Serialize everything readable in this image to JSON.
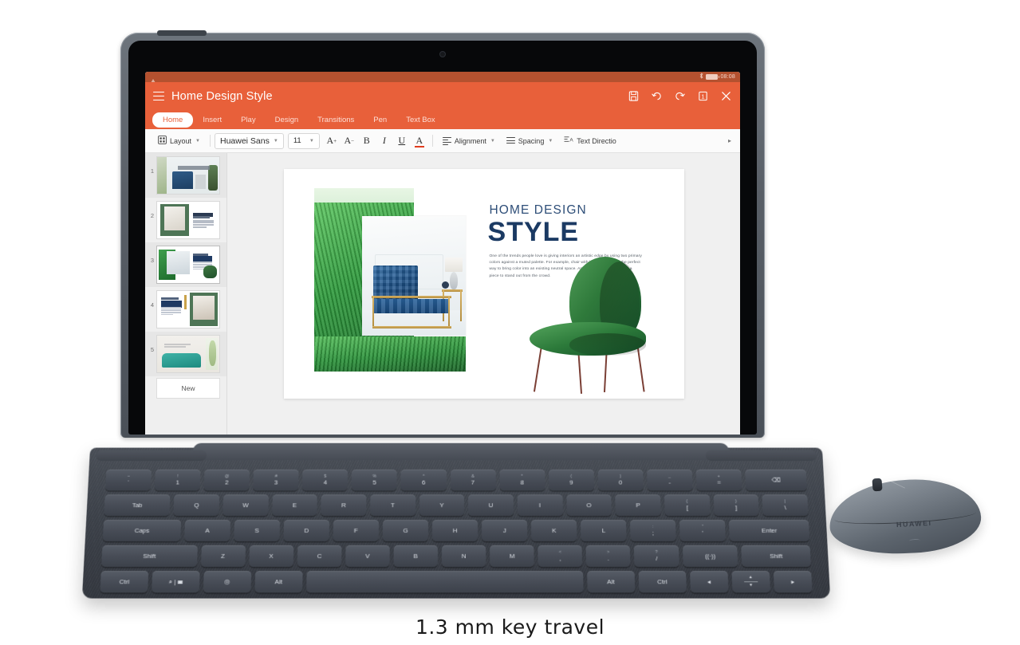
{
  "device": {
    "name": "huawei-tablet-with-keyboard-and-mouse",
    "mouse_brand": "HUAWEI"
  },
  "caption": "1.3 mm key travel",
  "status_bar": {
    "time": "08:08",
    "bluetooth_icon": "bluetooth-icon",
    "battery_icon": "battery-icon",
    "app_icon": "app-icon"
  },
  "titlebar": {
    "menu_icon": "hamburger-menu-icon",
    "document_title": "Home Design Style",
    "actions": [
      {
        "name": "save-icon",
        "label": "Save"
      },
      {
        "name": "undo-icon",
        "label": "Undo"
      },
      {
        "name": "redo-icon",
        "label": "Redo"
      },
      {
        "name": "page-number-icon",
        "label": "1"
      },
      {
        "name": "close-icon",
        "label": "Close"
      }
    ]
  },
  "ribbon": {
    "tabs": [
      {
        "label": "Home",
        "active": true
      },
      {
        "label": "Insert",
        "active": false
      },
      {
        "label": "Play",
        "active": false
      },
      {
        "label": "Design",
        "active": false
      },
      {
        "label": "Transitions",
        "active": false
      },
      {
        "label": "Pen",
        "active": false
      },
      {
        "label": "Text Box",
        "active": false
      }
    ]
  },
  "format_toolbar": {
    "layout_label": "Layout",
    "font_family": "Huawei Sans",
    "font_size": "11",
    "increase_font_label": "A",
    "decrease_font_label": "A",
    "bold_label": "B",
    "italic_label": "I",
    "underline_label": "U",
    "font_color_label": "A",
    "font_color_swatch": "#e03c1e",
    "alignment_label": "Alignment",
    "spacing_label": "Spacing",
    "text_direction_label": "Text Directio",
    "overflow_label": "▸"
  },
  "thumbnails": {
    "new_slide_label": "New",
    "slides": [
      {
        "number": "1",
        "title": "HOME DESIGN STYLE",
        "selected": false
      },
      {
        "number": "2",
        "title": "SIMPLICITY DESIGN STYLE",
        "selected": false
      },
      {
        "number": "3",
        "title": "HOME DESIGN STYLE",
        "selected": true
      },
      {
        "number": "4",
        "title": "HOME DESIGN STYLE",
        "selected": false
      },
      {
        "number": "5",
        "title": "",
        "selected": false
      }
    ]
  },
  "slide": {
    "title_small": "HOME DESIGN",
    "title_large": "STYLE",
    "body": "One of the trends people love is giving interiors an artistic edge by using two primary colors against a muted palette. For example, chair with big personality is the perfect way to bring color into an existing neutral space. And such vibrant color helps a piece to stand out from the crowd.",
    "colors": {
      "title_small": "#2e4e78",
      "title_large": "#1b3a63",
      "accent_green": "#2f7a3b",
      "accent_blue": "#1b4f86"
    }
  },
  "theme": {
    "app_accent": "#e8603a",
    "status_bar": "#b4512f",
    "toolbar_bg": "#fbfbfb",
    "panel_bg": "#efefef",
    "canvas_bg": "#f0f0f0"
  },
  "keyboard": {
    "rows": [
      [
        {
          "top": "~",
          "bot": "`",
          "cls": ""
        },
        {
          "top": "!",
          "bot": "1",
          "cls": ""
        },
        {
          "top": "@",
          "bot": "2",
          "cls": ""
        },
        {
          "top": "#",
          "bot": "3",
          "cls": ""
        },
        {
          "top": "$",
          "bot": "4",
          "cls": ""
        },
        {
          "top": "%",
          "bot": "5",
          "cls": ""
        },
        {
          "top": "^",
          "bot": "6",
          "cls": ""
        },
        {
          "top": "&",
          "bot": "7",
          "cls": ""
        },
        {
          "top": "*",
          "bot": "8",
          "cls": ""
        },
        {
          "top": "(",
          "bot": "9",
          "cls": ""
        },
        {
          "top": ")",
          "bot": "0",
          "cls": ""
        },
        {
          "top": "_",
          "bot": "-",
          "cls": ""
        },
        {
          "top": "+",
          "bot": "=",
          "cls": ""
        },
        {
          "top": "",
          "bot": "⌫",
          "cls": "w-bs"
        }
      ],
      [
        {
          "top": "",
          "bot": "Tab",
          "cls": "w-tab"
        },
        {
          "top": "",
          "bot": "Q",
          "cls": ""
        },
        {
          "top": "",
          "bot": "W",
          "cls": ""
        },
        {
          "top": "",
          "bot": "E",
          "cls": ""
        },
        {
          "top": "",
          "bot": "R",
          "cls": ""
        },
        {
          "top": "",
          "bot": "T",
          "cls": ""
        },
        {
          "top": "",
          "bot": "Y",
          "cls": ""
        },
        {
          "top": "",
          "bot": "U",
          "cls": ""
        },
        {
          "top": "",
          "bot": "I",
          "cls": ""
        },
        {
          "top": "",
          "bot": "O",
          "cls": ""
        },
        {
          "top": "",
          "bot": "P",
          "cls": ""
        },
        {
          "top": "{",
          "bot": "[",
          "cls": ""
        },
        {
          "top": "}",
          "bot": "]",
          "cls": ""
        },
        {
          "top": "|",
          "bot": "\\",
          "cls": ""
        }
      ],
      [
        {
          "top": "",
          "bot": "Caps",
          "cls": "w-caps"
        },
        {
          "top": "",
          "bot": "A",
          "cls": ""
        },
        {
          "top": "",
          "bot": "S",
          "cls": ""
        },
        {
          "top": "",
          "bot": "D",
          "cls": ""
        },
        {
          "top": "",
          "bot": "F",
          "cls": ""
        },
        {
          "top": "",
          "bot": "G",
          "cls": ""
        },
        {
          "top": "",
          "bot": "H",
          "cls": ""
        },
        {
          "top": "",
          "bot": "J",
          "cls": ""
        },
        {
          "top": "",
          "bot": "K",
          "cls": ""
        },
        {
          "top": "",
          "bot": "L",
          "cls": ""
        },
        {
          "top": ":",
          "bot": ";",
          "cls": ""
        },
        {
          "top": "\"",
          "bot": "'",
          "cls": ""
        },
        {
          "top": "",
          "bot": "Enter",
          "cls": "w-enter"
        }
      ],
      [
        {
          "top": "",
          "bot": "Shift",
          "cls": "w-shift"
        },
        {
          "top": "",
          "bot": "Z",
          "cls": ""
        },
        {
          "top": "",
          "bot": "X",
          "cls": ""
        },
        {
          "top": "",
          "bot": "C",
          "cls": ""
        },
        {
          "top": "",
          "bot": "V",
          "cls": ""
        },
        {
          "top": "",
          "bot": "B",
          "cls": ""
        },
        {
          "top": "",
          "bot": "N",
          "cls": ""
        },
        {
          "top": "",
          "bot": "M",
          "cls": ""
        },
        {
          "top": "<",
          "bot": ",",
          "cls": ""
        },
        {
          "top": ">",
          "bot": ".",
          "cls": ""
        },
        {
          "top": "?",
          "bot": "/",
          "cls": ""
        },
        {
          "top": "",
          "bot": "((·))",
          "cls": "w-fn"
        },
        {
          "top": "",
          "bot": "Shift",
          "cls": "w-shift-r"
        }
      ],
      [
        {
          "top": "",
          "bot": "Ctrl",
          "cls": "w-ctrl"
        },
        {
          "top": "",
          "bot": "⌕ | ⌨",
          "cls": "w-ctrl"
        },
        {
          "top": "",
          "bot": "◎",
          "cls": "w-ctrl"
        },
        {
          "top": "",
          "bot": "Alt",
          "cls": "w-ctrl"
        },
        {
          "top": "",
          "bot": "",
          "cls": "w-space"
        },
        {
          "top": "",
          "bot": "Alt",
          "cls": "w-ctrl"
        },
        {
          "top": "",
          "bot": "Ctrl",
          "cls": "w-ctrl"
        },
        {
          "top": "",
          "bot": "◂",
          "cls": "w-arrow"
        },
        {
          "top": "",
          "bot": "updown",
          "cls": "w-updown"
        },
        {
          "top": "",
          "bot": "▸",
          "cls": "w-arrow"
        }
      ]
    ]
  }
}
